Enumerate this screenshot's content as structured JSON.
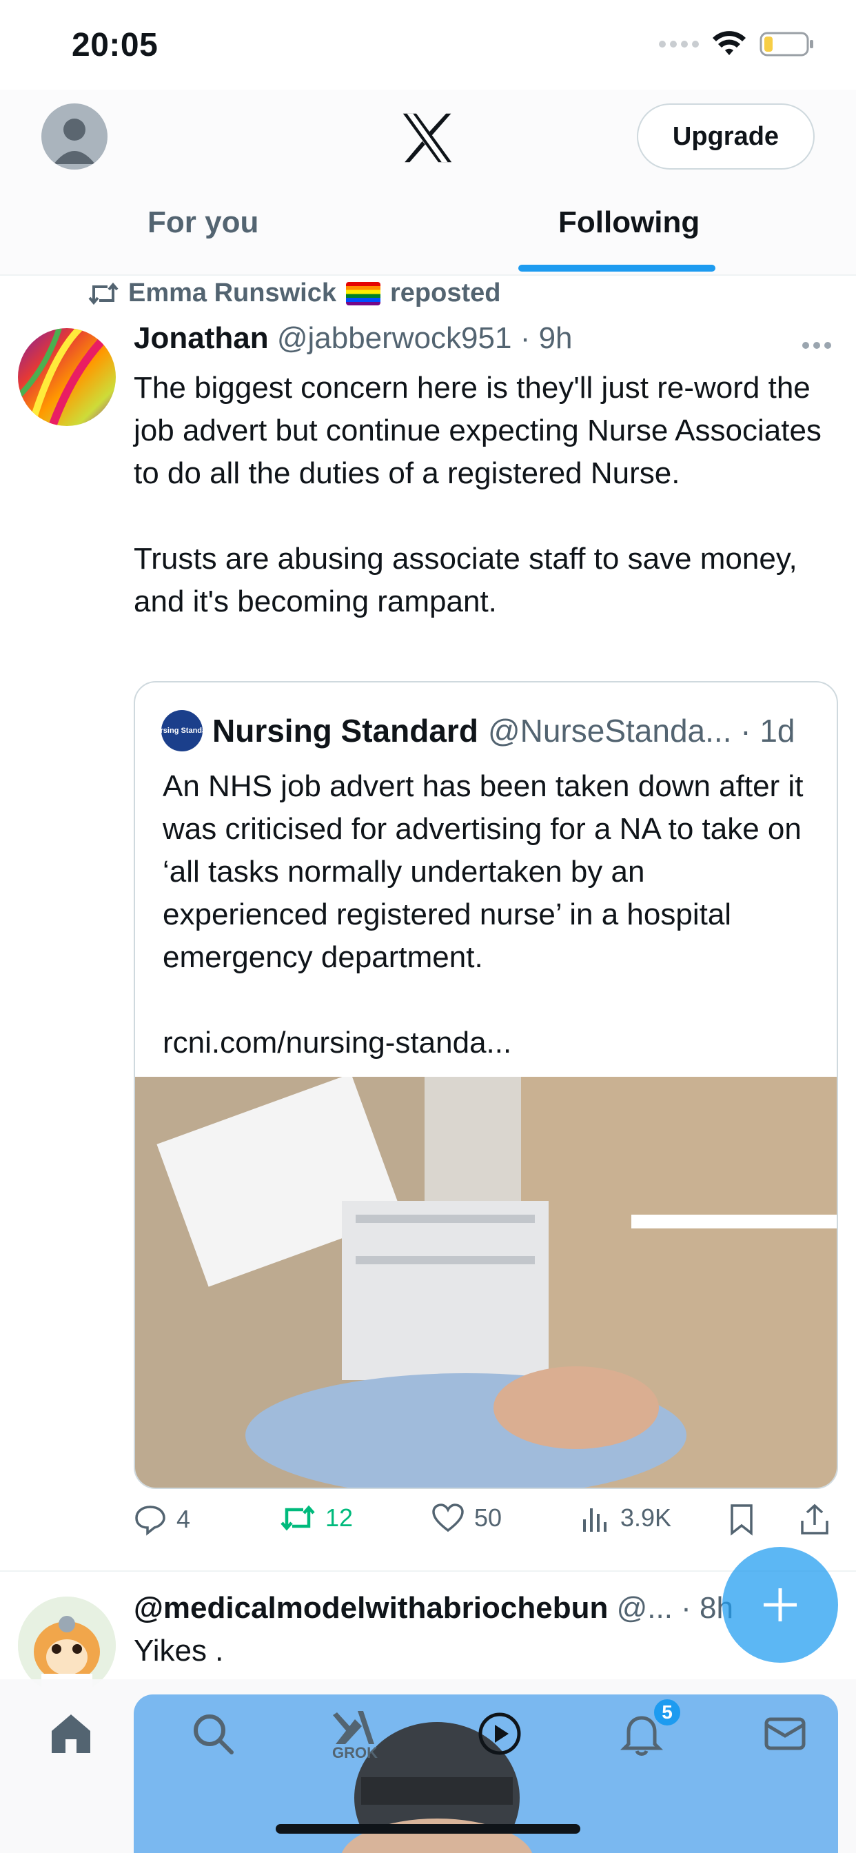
{
  "status_bar": {
    "time": "20:05"
  },
  "header": {
    "upgrade_label": "Upgrade",
    "tabs": [
      {
        "label": "For you",
        "active": false
      },
      {
        "label": "Following",
        "active": true
      }
    ]
  },
  "post1": {
    "repost_by": "Emma Runswick",
    "repost_suffix": "reposted",
    "author_name": "Jonathan",
    "author_handle": "@jabberwock951",
    "time": "· 9h",
    "body_p1": "The biggest concern here is they'll just re-word the job advert but continue expecting Nurse Associates to do all the duties of a registered Nurse.",
    "body_p2": "Trusts are abusing associate staff to save money, and it's becoming rampant.",
    "quote": {
      "logo_text": "Nursing Standard",
      "author_name": "Nursing Standard",
      "author_handle": "@NurseStanda... · 1d",
      "text_p1": "An NHS job advert has been taken down after it was criticised for advertising for a NA to take on ‘all tasks normally undertaken by an experienced registered nurse’ in a hospital emergency department.",
      "link": "rcni.com/nursing-standa..."
    },
    "actions": {
      "replies": "4",
      "reposts": "12",
      "likes": "50",
      "views": "3.9K"
    }
  },
  "post2": {
    "author_name": "@medicalmodelwithabriochebun",
    "author_handle": "@... · 8h",
    "body": "Yikes ."
  },
  "bottom_nav": {
    "grok_label": "GROK",
    "notifications_count": "5"
  },
  "colors": {
    "accent": "#1d9bf0",
    "repost_green": "#00ba7c",
    "secondary_text": "#536471"
  }
}
